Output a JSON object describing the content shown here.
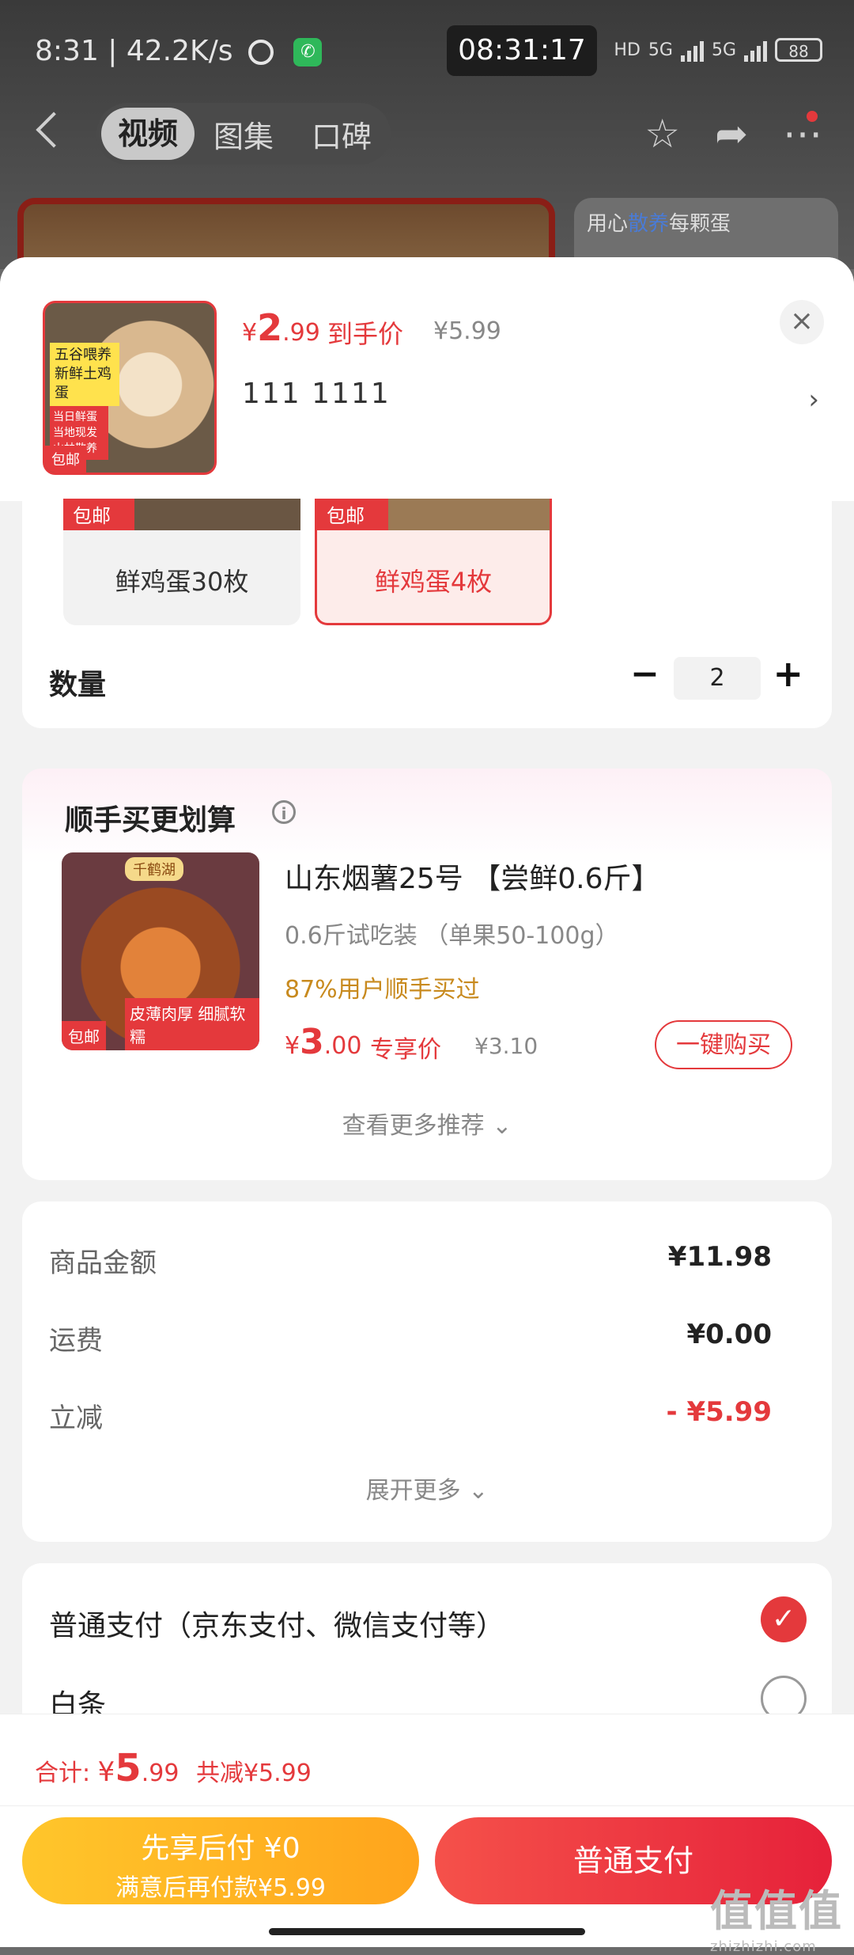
{
  "status_bar": {
    "time": "8:31",
    "speed": "42.2K/s",
    "clock": "08:31:17",
    "hd": "HD",
    "net1": "5G",
    "net2": "5G",
    "battery": "88"
  },
  "nav": {
    "tabs": [
      "视频",
      "图集",
      "口碑"
    ],
    "active_tab": "视频"
  },
  "peek": {
    "right_text_1": "用心",
    "right_text_2": "散养",
    "right_text_3": "每颗蛋"
  },
  "product": {
    "thumb_tag1": "五谷喂养 新鲜土鸡蛋",
    "thumb_tag2": "当日鲜蛋 当地现发 山林散养",
    "thumb_tag3": "包邮",
    "price_currency": "¥",
    "price_int": "2",
    "price_dec": ".99",
    "price_label": "到手价",
    "price_original": "¥5.99",
    "spec": "111  1111"
  },
  "options": [
    {
      "badge": "包邮",
      "label": "鲜鸡蛋30枚",
      "selected": false
    },
    {
      "badge": "包邮",
      "label": "鲜鸡蛋4枚",
      "selected": true
    }
  ],
  "quantity": {
    "label": "数量",
    "value": "2",
    "minus": "−",
    "plus": "+"
  },
  "recommend": {
    "title": "顺手买更划算",
    "image_tag": "千鹤湖",
    "image_badge1": "包邮",
    "image_badge2": "皮薄肉厚 细腻软糯",
    "name": "山东烟薯25号 【尝鲜0.6斤】",
    "sub": "0.6斤试吃装 （单果50-100g）",
    "stat": "87%用户顺手买过",
    "price_currency": "¥",
    "price_int": "3",
    "price_dec": ".00",
    "price_label": "专享价",
    "price_original": "¥3.10",
    "buy_label": "一键购买",
    "more_label": "查看更多推荐 ⌄"
  },
  "summary": {
    "rows": [
      {
        "label": "商品金额",
        "value": "¥11.98"
      },
      {
        "label": "运费",
        "value": "¥0.00"
      },
      {
        "label": "立减",
        "value": "- ¥5.99"
      }
    ],
    "expand_label": "展开更多 ⌄"
  },
  "payment": {
    "option1": "普通支付（京东支付、微信支付等）",
    "option2": "白条"
  },
  "bottom": {
    "total_label": "合计:",
    "total_currency": "¥",
    "total_int": "5",
    "total_dec": ".99",
    "saved": "共减¥5.99",
    "later_l1": "先享后付 ¥0",
    "later_l2": "满意后再付款¥5.99",
    "pay_label": "普通支付"
  },
  "watermark": {
    "main": "值值值",
    "sub": "zhizhizhi.com"
  },
  "colors": {
    "accent": "#e4393c",
    "yellow": "#ffb51f",
    "stat": "#c88a1e"
  }
}
